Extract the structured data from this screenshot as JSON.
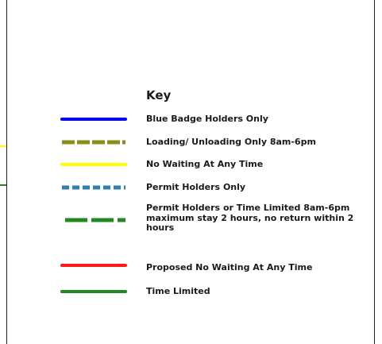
{
  "legend": {
    "title": "Key",
    "items": [
      {
        "label": "Blue Badge Holders Only",
        "color": "#0000ee",
        "style": "solid"
      },
      {
        "label": "Loading/ Unloading Only 8am-6pm",
        "color": "#8c8c1a",
        "style": "dashed"
      },
      {
        "label": "No Waiting At Any Time",
        "color": "#ffff00",
        "style": "solid"
      },
      {
        "label": "Permit Holders Only",
        "color": "#2f7fb5",
        "style": "dashed-fine"
      },
      {
        "label": "Permit Holders or Time Limited 8am-6pm\nmaximum stay 2 hours, no return within 2\nhours",
        "color": "#1f8a1f",
        "style": "dashed-long"
      },
      {
        "label": "Proposed No Waiting At Any Time",
        "color": "#ff1a1a",
        "style": "solid"
      },
      {
        "label": "Time Limited",
        "color": "#1f8a1f",
        "style": "solid"
      }
    ]
  },
  "colors": {
    "border": "#222222",
    "background": "#ffffff",
    "edge_marks": [
      "#ffff00",
      "#1f8a1f"
    ]
  }
}
